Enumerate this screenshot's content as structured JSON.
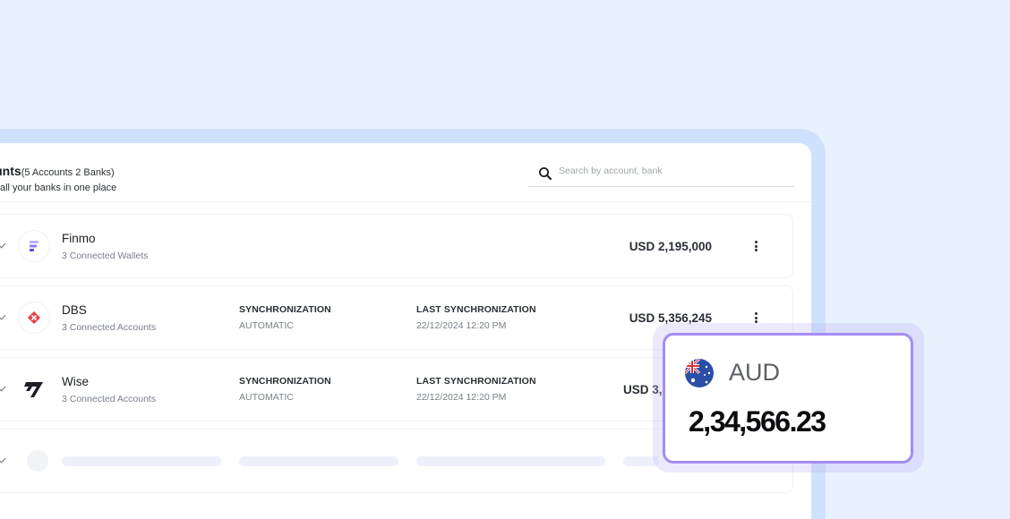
{
  "header": {
    "title": "ccounts",
    "count_note": "(5 Accounts 2 Banks)",
    "subtitle": "nnect all your banks in one place"
  },
  "search": {
    "placeholder": "Search by account, bank",
    "value": "",
    "icon": "search-icon"
  },
  "columns": {
    "sync_label": "SYNCHRONIZATION",
    "last_sync_label": "LAST SYNCHRONIZATION"
  },
  "banks": [
    {
      "name": "Finmo",
      "sub": "3 Connected Wallets",
      "amount": "USD 2,195,000",
      "logo": "finmo-logo"
    },
    {
      "name": "DBS",
      "sub": "3 Connected Accounts",
      "sync": "AUTOMATIC",
      "last_sync": "22/12/2024 12:20 PM",
      "amount": "USD 5,356,245",
      "logo": "dbs-logo"
    },
    {
      "name": "Wise",
      "sub": "3 Connected Accounts",
      "sync": "AUTOMATIC",
      "last_sync": "22/12/2024 12:20 PM",
      "amount": "USD 3,",
      "logo": "wise-logo"
    }
  ],
  "popup": {
    "currency": "AUD",
    "amount": "2,34,566.23",
    "flag": "australia-flag-icon"
  },
  "colors": {
    "background": "#e8f1fe",
    "frame": "#cfe2fd",
    "accent": "#a58df2",
    "dbs_red": "#e8414b",
    "finmo_purple": "#6b5cf0"
  }
}
